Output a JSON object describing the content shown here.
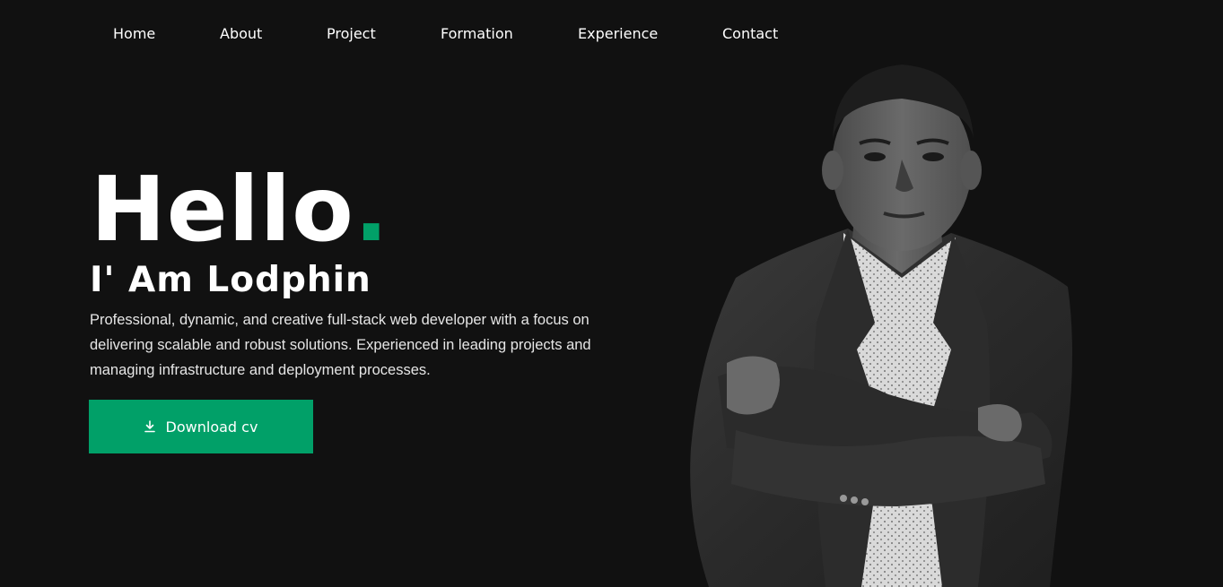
{
  "nav": {
    "items": [
      {
        "label": "Home"
      },
      {
        "label": "About"
      },
      {
        "label": "Project"
      },
      {
        "label": "Formation"
      },
      {
        "label": "Experience"
      },
      {
        "label": "Contact"
      }
    ]
  },
  "hero": {
    "greeting": "Hello",
    "greeting_dot": ".",
    "name_line": "I' Am Lodphin",
    "description": "Professional, dynamic, and creative full-stack web developer with a focus on delivering scalable and robust solutions. Experienced in leading projects and managing infrastructure and deployment processes.",
    "download_label": "Download cv",
    "download_icon": "download-icon",
    "portrait": "portrait-photo"
  },
  "colors": {
    "background": "#111111",
    "accent": "#01a068",
    "text": "#ffffff"
  }
}
